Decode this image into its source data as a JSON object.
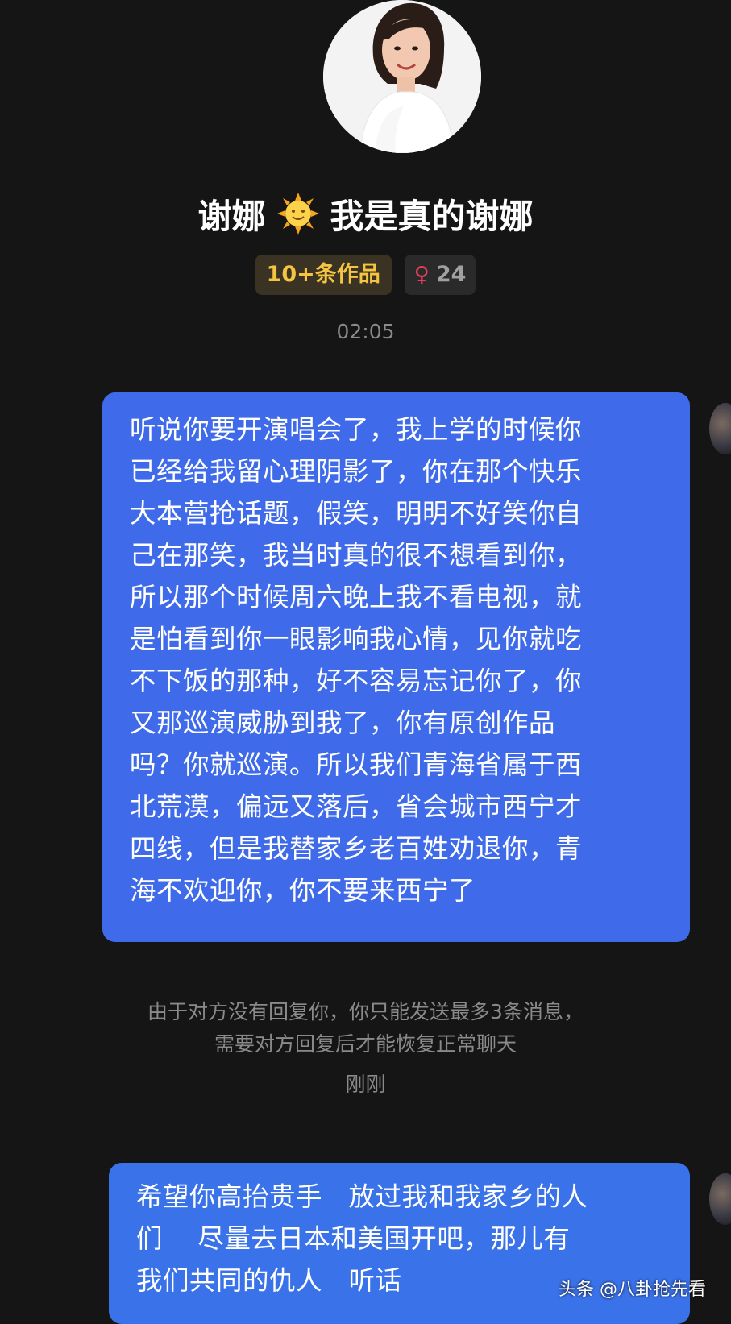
{
  "profile": {
    "name_part1": "谢娜",
    "name_emoji": "sun-with-face-icon",
    "name_part2": "我是真的谢娜",
    "works_badge": "10+条作品",
    "age_badge": "24",
    "gender_icon": "female-icon"
  },
  "messages": [
    {
      "time": "02:05",
      "lines": [
        "听说你要开演唱会了，我上学的时候你",
        "已经给我留心理阴影了，你在那个快乐",
        "大本营抢话题，假笑，明明不好笑你自",
        "己在那笑，我当时真的很不想看到你，",
        "所以那个时候周六晚上我不看电视，就",
        "是怕看到你一眼影响我心情，见你就吃",
        "不下饭的那种，好不容易忘记你了，你",
        "又那巡演威胁到我了，你有原创作品",
        "吗？你就巡演。所以我们青海省属于西",
        "北荒漠，偏远又落后，省会城市西宁才",
        "四线，但是我替家乡老百姓劝退你，青",
        "海不欢迎你，你不要来西宁了"
      ]
    },
    {
      "time": "刚刚",
      "lines": [
        "希望你高抬贵手   放过我和我家乡的人",
        "们    尽量去日本和美国开吧，那儿有",
        "我们共同的仇人   听话"
      ]
    }
  ],
  "notice": {
    "line1": "由于对方没有回复你，你只能发送最多3条消息，",
    "line2": "需要对方回复后才能恢复正常聊天"
  },
  "watermark": "头条 @八卦抢先看",
  "colors": {
    "background": "#151515",
    "bubble": "#3f6bea",
    "works_badge_text": "#f5c542",
    "muted_text": "#8a8a8a"
  }
}
